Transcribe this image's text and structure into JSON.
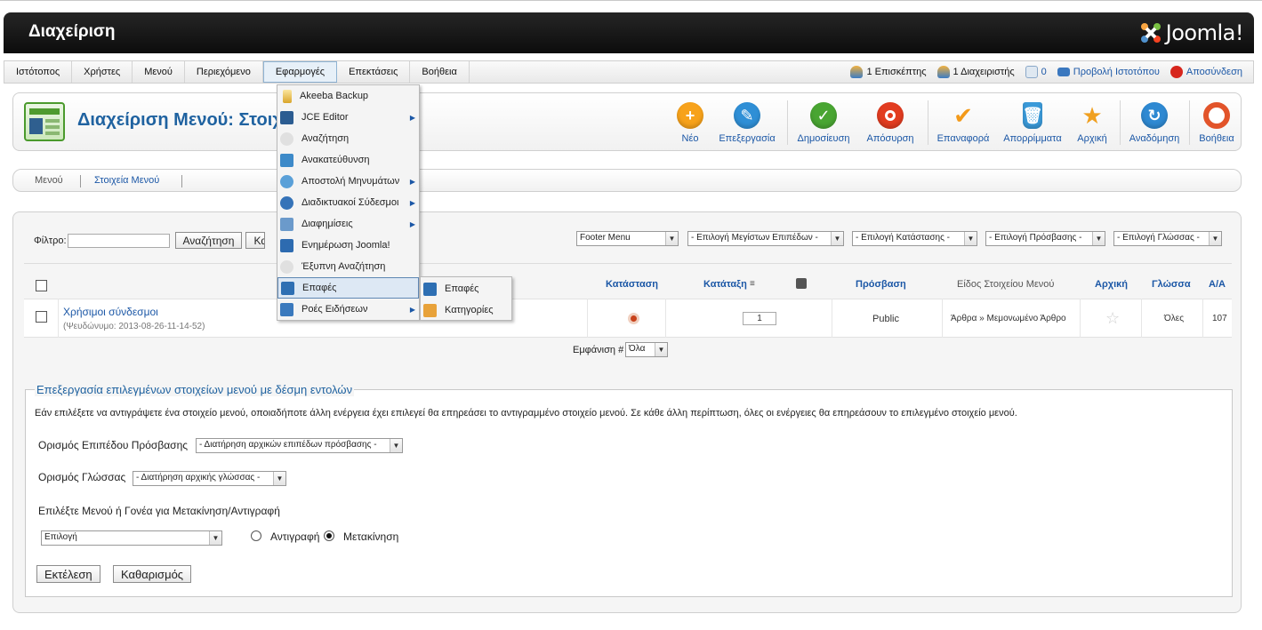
{
  "header": {
    "title": "Διαχείριση",
    "logo_text": "Joomla!"
  },
  "menubar": {
    "items": [
      {
        "label": "Ιστότοπος"
      },
      {
        "label": "Χρήστες"
      },
      {
        "label": "Μενού"
      },
      {
        "label": "Περιεχόμενο"
      },
      {
        "label": "Εφαρμογές"
      },
      {
        "label": "Επεκτάσεις"
      },
      {
        "label": "Βοήθεια"
      }
    ],
    "active_item": "Εφαρμογές",
    "status": {
      "visitors": "1 Επισκέπτης",
      "admins": "1 Διαχειριστής",
      "messages": "0",
      "view_site": "Προβολή Ιστοτόπου",
      "logout": "Αποσύνδεση"
    }
  },
  "toolbar": {
    "page_title": "Διαχείριση Μενού: Στοιχεία Μενού",
    "buttons": [
      {
        "label": "Νέο",
        "icon": "plus-icon",
        "color": "#f7a21b"
      },
      {
        "label": "Επεξεργασία",
        "icon": "pencil-icon",
        "color": "#2f8fd6"
      },
      {
        "label": "Δημοσίευση",
        "icon": "check-icon",
        "color": "#49a532"
      },
      {
        "label": "Απόσυρση",
        "icon": "unpublish-icon",
        "color": "#e23c20"
      },
      {
        "label": "Επαναφορά",
        "icon": "checkmark-icon",
        "color": "#f39a1a"
      },
      {
        "label": "Απορρίμματα",
        "icon": "trash-icon",
        "color": "#3a9ad9"
      },
      {
        "label": "Αρχική",
        "icon": "star-icon",
        "color": "#f0a020"
      },
      {
        "label": "Αναδόμηση",
        "icon": "refresh-icon",
        "color": "#2e89d2"
      },
      {
        "label": "Βοήθεια",
        "icon": "lifebuoy-icon",
        "color": "#e2542a"
      }
    ]
  },
  "submenu": {
    "items": [
      "Μενού",
      "Στοιχεία Μενού"
    ],
    "active": "Στοιχεία Μενού"
  },
  "filter": {
    "label": "Φίλτρο:",
    "search_value": "",
    "search_button": "Αναζήτηση",
    "clear_button": "Κα",
    "selects": [
      "Footer Menu",
      "- Επιλογή Μεγίστων Επιπέδων -",
      "- Επιλογή Κατάστασης -",
      "- Επιλογή Πρόσβασης -",
      "- Επιλογή Γλώσσας -"
    ]
  },
  "table": {
    "headers": {
      "status": "Κατάσταση",
      "ordering": "Κατάταξη",
      "access": "Πρόσβαση",
      "type": "Είδος Στοιχείου Μενού",
      "home": "Αρχική",
      "language": "Γλώσσα",
      "id": "Α/Α"
    },
    "rows": [
      {
        "title": "Χρήσιμοι σύνδεσμοι",
        "alias": "(Ψευδώνυμο: 2013-08-26-11-14-52)",
        "order": "1",
        "access": "Public",
        "type": "Άρθρα » Μεμονωμένο Άρθρο",
        "language": "Όλες",
        "id": "107"
      }
    ],
    "display_label": "Εμφάνιση #",
    "display_value": "Όλα"
  },
  "batch": {
    "legend": "Επεξεργασία επιλεγμένων στοιχείων μενού με δέσμη εντολών",
    "note": "Εάν επιλέξετε να αντιγράψετε ένα στοιχείο μενού, οποιαδήποτε άλλη ενέργεια έχει επιλεγεί θα επηρεάσει το αντιγραμμένο στοιχείο μενού. Σε κάθε άλλη περίπτωση, όλες οι ενέργειες θα επηρεάσουν το επιλεγμένο στοιχείο μενού.",
    "access_label": "Ορισμός Επιπέδου Πρόσβασης",
    "access_value": "- Διατήρηση αρχικών επιπέδων πρόσβασης -",
    "language_label": "Ορισμός Γλώσσας",
    "language_value": "- Διατήρηση αρχικής γλώσσας -",
    "move_label": "Επιλέξτε Μενού ή Γονέα για Μετακίνηση/Αντιγραφή",
    "move_value": "Επιλογή",
    "copy_label": "Αντιγραφή",
    "move_radio_label": "Μετακίνηση",
    "run_button": "Εκτέλεση",
    "clear_button": "Καθαρισμός"
  },
  "dropdown": {
    "items": [
      {
        "label": "Akeeba Backup",
        "icon": "akeeba-icon",
        "color": "#d9a52a"
      },
      {
        "label": "JCE Editor",
        "icon": "jce-icon",
        "color": "#2b5c91",
        "submenu": true
      },
      {
        "label": "Αναζήτηση",
        "icon": "search-icon",
        "color": "#c8c8c8"
      },
      {
        "label": "Ανακατεύθυνση",
        "icon": "redirect-icon",
        "color": "#3d8ac9"
      },
      {
        "label": "Αποστολή Μηνυμάτων",
        "icon": "messaging-icon",
        "color": "#5aa0d8",
        "submenu": true
      },
      {
        "label": "Διαδικτυακοί Σύδεσμοι",
        "icon": "weblinks-icon",
        "color": "#3573b8",
        "submenu": true
      },
      {
        "label": "Διαφημίσεις",
        "icon": "banners-icon",
        "color": "#6b9acb",
        "submenu": true
      },
      {
        "label": "Ενημέρωση Joomla!",
        "icon": "update-icon",
        "color": "#2d6bb0"
      },
      {
        "label": "Έξυπνη Αναζήτηση",
        "icon": "finder-icon",
        "color": "#c8c8c8"
      },
      {
        "label": "Επαφές",
        "icon": "contacts-icon",
        "color": "#2e6fb3",
        "submenu": true
      },
      {
        "label": "Ροές Ειδήσεων",
        "icon": "rss-icon",
        "color": "#3a79bd",
        "submenu": true
      }
    ],
    "highlighted": "Επαφές",
    "flyout": [
      {
        "label": "Επαφές",
        "icon": "contacts-icon",
        "color": "#2e6fb3"
      },
      {
        "label": "Κατηγορίες",
        "icon": "categories-icon",
        "color": "#e8a23a"
      }
    ]
  }
}
